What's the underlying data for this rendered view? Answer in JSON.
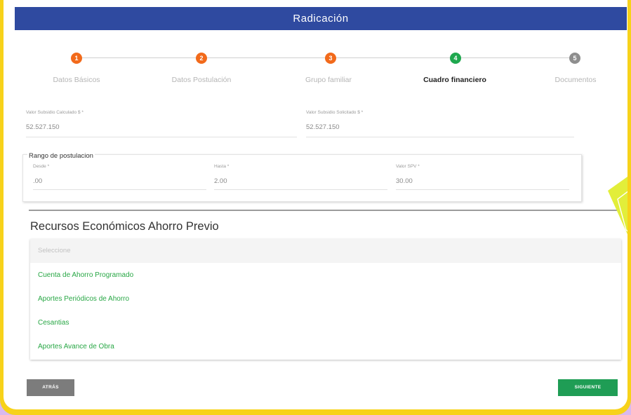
{
  "header": {
    "title": "Radicación"
  },
  "steps": [
    {
      "number": "1",
      "label": "Datos Básicos",
      "state": "done",
      "color": "#f26a1b"
    },
    {
      "number": "2",
      "label": "Datos Postulación",
      "state": "done",
      "color": "#f26a1b"
    },
    {
      "number": "3",
      "label": "Grupo familiar",
      "state": "done",
      "color": "#f26a1b"
    },
    {
      "number": "4",
      "label": "Cuadro financiero",
      "state": "active",
      "color": "#1fa84f"
    },
    {
      "number": "5",
      "label": "Documentos",
      "state": "pending",
      "color": "#8e8e8e"
    }
  ],
  "subsidy": {
    "calculated_label": "Valor Subsidio Calculado $ *",
    "calculated_value": "52.527.150",
    "requested_label": "Valor Subsidio Solicitado $ *",
    "requested_value": "52.527.150"
  },
  "range": {
    "title": "Rango de postulacion",
    "desde_label": "Desde *",
    "desde_value": ".00",
    "hasta_label": "Hasta *",
    "hasta_value": "2.00",
    "spv_label": "Valor SPV *",
    "spv_value": "30.00"
  },
  "resources": {
    "title": "Recursos Económicos Ahorro Previo",
    "placeholder": "Seleccione",
    "options": [
      "Cuenta de Ahorro Programado",
      "Aportes Periódicos de Ahorro",
      "Cesantias",
      "Aportes Avance de Obra"
    ]
  },
  "buttons": {
    "back": "ATRÁS",
    "next": "SIGUIENTE"
  },
  "colors": {
    "header": "#2f4aa0",
    "accent_green": "#1f9d55",
    "list_green": "#28a745",
    "frame_yellow": "#f7d21a",
    "frame_lilac": "#d9b9ee"
  }
}
